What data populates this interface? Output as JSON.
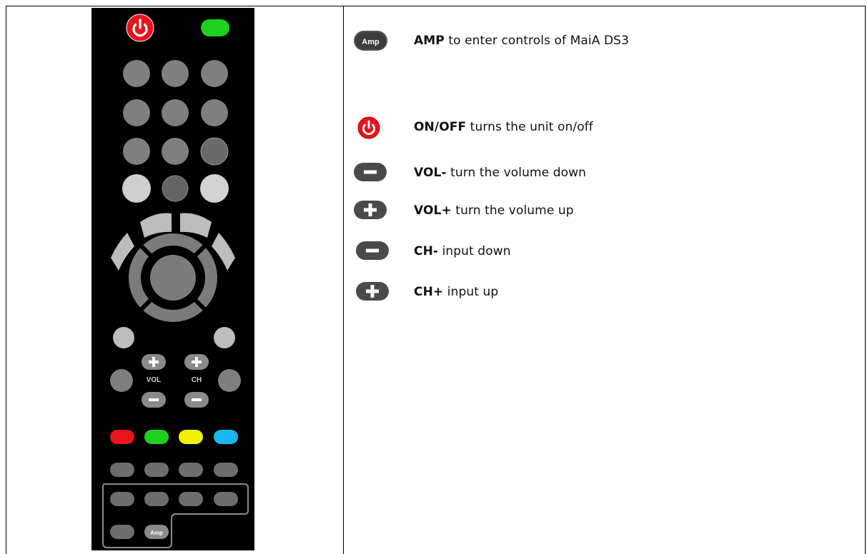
{
  "remote": {
    "amp_label": "Amp",
    "vol_label": "VOL",
    "ch_label": "CH"
  },
  "legend": [
    {
      "icon": "amp-button-icon",
      "key": "AMP",
      "text": " to enter controls of MaiA DS3"
    },
    {
      "icon": "power-icon",
      "key": "ON/OFF",
      "text": " turns the unit on/off"
    },
    {
      "icon": "minus-icon",
      "key": "VOL-",
      "text": " turn the volume down"
    },
    {
      "icon": "plus-icon",
      "key": "VOL+",
      "text": " turn the volume up"
    },
    {
      "icon": "minus-icon",
      "key": "CH-",
      "text": " input down"
    },
    {
      "icon": "plus-icon",
      "key": "CH+",
      "text": " input up"
    }
  ],
  "colors": {
    "power": "#e8141c",
    "green": "#1ed01e",
    "yellow": "#f2f200",
    "blue": "#16b8f0",
    "button_gray": "#808080",
    "button_dark": "#555555"
  }
}
